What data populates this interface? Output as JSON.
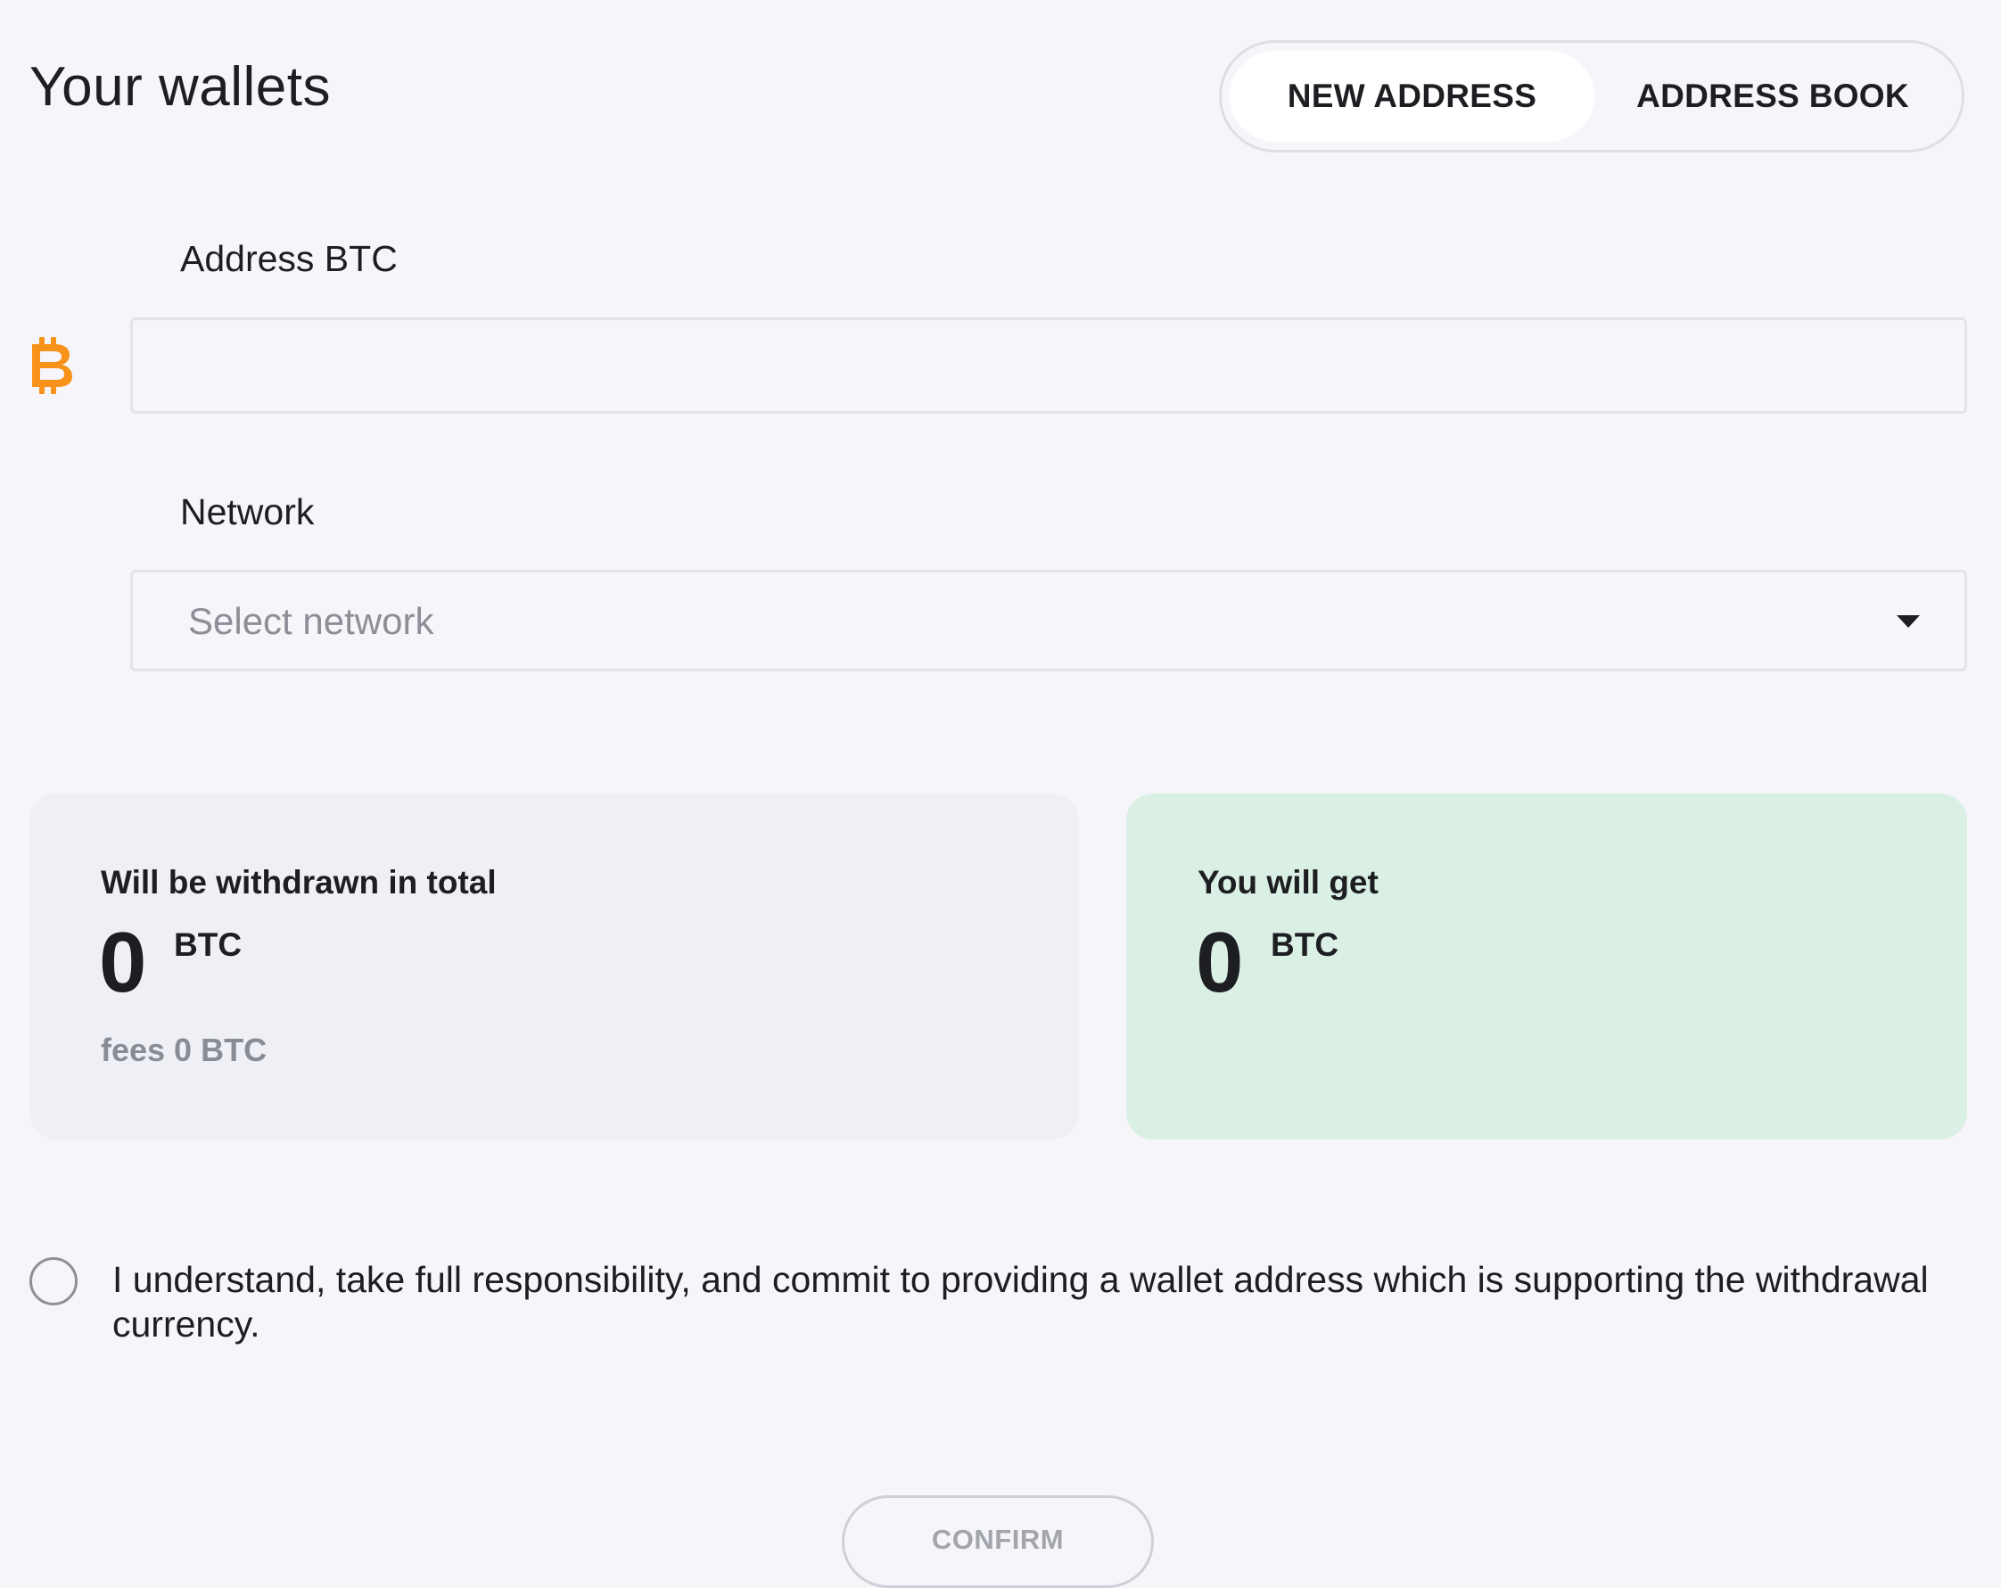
{
  "header": {
    "title": "Your wallets"
  },
  "tabs": [
    {
      "label": "NEW ADDRESS",
      "active": true
    },
    {
      "label": "ADDRESS BOOK",
      "active": false
    }
  ],
  "form": {
    "address": {
      "label": "Address BTC",
      "value": "",
      "placeholder": "",
      "currency_icon": "bitcoin-icon",
      "currency_color": "#f7931a"
    },
    "network": {
      "label": "Network",
      "placeholder": "Select network",
      "selected": "",
      "icon": "caret-down-icon"
    }
  },
  "summary": {
    "withdrawn": {
      "label": "Will be withdrawn in total",
      "amount": "0",
      "currency": "BTC",
      "fees": "fees 0 BTC"
    },
    "receive": {
      "label": "You will get",
      "amount": "0",
      "currency": "BTC",
      "background": "#dbf0e5"
    }
  },
  "consent": {
    "checked": false,
    "text": "I understand, take full responsibility, and commit to providing a wallet address which is supporting the withdrawal currency."
  },
  "actions": {
    "confirm_label": "CONFIRM",
    "confirm_disabled": true
  }
}
